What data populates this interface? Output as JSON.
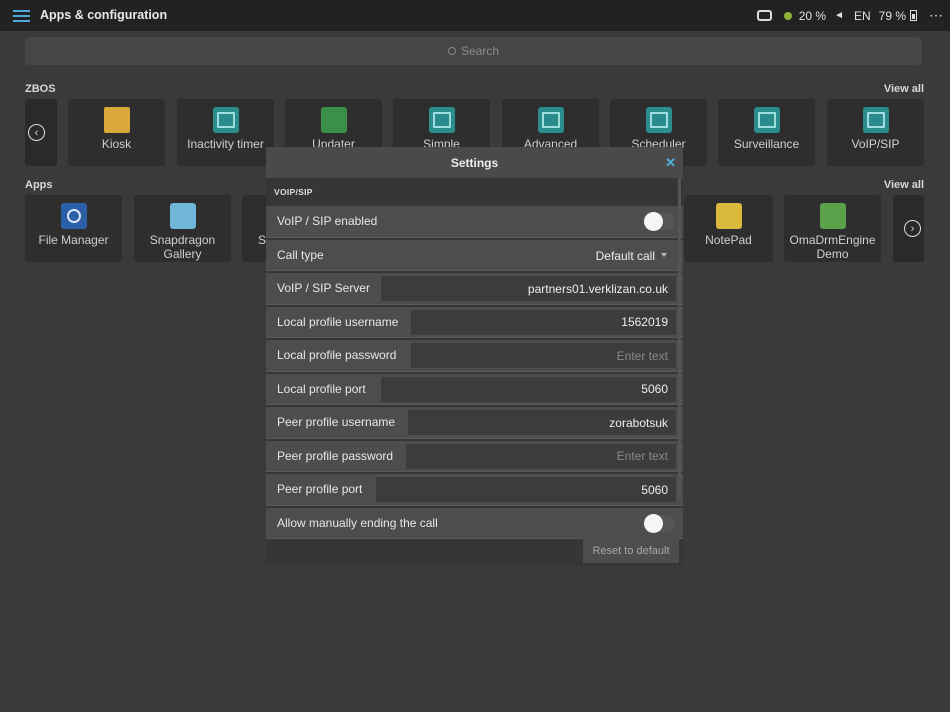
{
  "topbar": {
    "title": "Apps & configuration",
    "status": {
      "wifi_percent": "20 %",
      "language": "EN",
      "battery_percent": "79 %"
    },
    "icons": [
      "menu-icon",
      "device-icon",
      "status-dot-icon",
      "volume-icon",
      "battery-icon",
      "more-icon"
    ]
  },
  "search": {
    "placeholder": "Search"
  },
  "zbos": {
    "label": "ZBOS",
    "view_all": "View all",
    "tiles": [
      {
        "label": "Kiosk",
        "icon": "folder-icon"
      },
      {
        "label": "Inactivity timer",
        "icon": "image-icon"
      },
      {
        "label": "Updater",
        "icon": "android-icon"
      },
      {
        "label": "Simple",
        "icon": "image-icon"
      },
      {
        "label": "Advanced",
        "icon": "image-icon"
      },
      {
        "label": "Scheduler",
        "icon": "image-icon"
      },
      {
        "label": "Surveillance",
        "icon": "image-icon"
      },
      {
        "label": "VoIP/SIP",
        "icon": "image-icon"
      }
    ]
  },
  "apps": {
    "label": "Apps",
    "view_all": "View all",
    "tiles": [
      {
        "label": "File Manager",
        "icon": "camera-lens-icon"
      },
      {
        "label": "Snapdragon Gallery",
        "icon": "gallery-icon"
      },
      {
        "label": "S",
        "icon": "app-icon"
      },
      {
        "label": "NotePad",
        "icon": "notepad-icon"
      },
      {
        "label": "OmaDrmEngine Demo",
        "icon": "lock-icon"
      }
    ]
  },
  "dialog": {
    "title": "Settings",
    "section": "VOIP/SIP",
    "voip_enabled_label": "VoIP / SIP enabled",
    "call_type_label": "Call type",
    "call_type_value": "Default call",
    "server_label": "VoIP / SIP Server",
    "server_value": "partners01.verklizan.co.uk",
    "local_user_label": "Local profile username",
    "local_user_value": "1562019",
    "local_pass_label": "Local profile password",
    "local_pass_placeholder": "Enter text",
    "local_port_label": "Local profile port",
    "local_port_value": "5060",
    "peer_user_label": "Peer profile username",
    "peer_user_value": "zorabotsuk",
    "peer_pass_label": "Peer profile password",
    "peer_pass_placeholder": "Enter text",
    "peer_port_label": "Peer profile port",
    "peer_port_value": "5060",
    "manual_end_label": "Allow manually ending the call",
    "reset_label": "Reset to default"
  },
  "colors": {
    "accent": "#4fa9d9",
    "background": "#3a3a3a",
    "topbar": "#222222"
  }
}
